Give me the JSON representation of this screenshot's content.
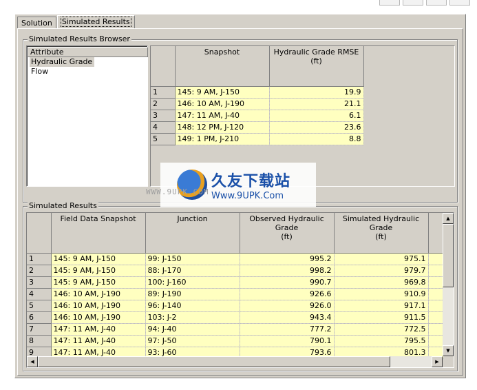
{
  "top_icons": [
    "toolbar-icon-1",
    "toolbar-icon-2",
    "toolbar-icon-3",
    "toolbar-icon-4"
  ],
  "tabs": [
    {
      "label": "Solution"
    },
    {
      "label": "Simulated Results"
    }
  ],
  "browser": {
    "title": "Simulated Results Browser",
    "attribute_header": "Attribute",
    "attributes": [
      "Hydraulic Grade",
      "Flow"
    ],
    "selected_attribute": "Hydraulic Grade",
    "columns": [
      "Snapshot",
      "Hydraulic Grade RMSE\n(ft)"
    ],
    "rows": [
      {
        "n": "1",
        "snapshot": "145: 9 AM, J-150",
        "rmse": "19.9"
      },
      {
        "n": "2",
        "snapshot": "146: 10 AM, J-190",
        "rmse": "21.1"
      },
      {
        "n": "3",
        "snapshot": "147: 11 AM, J-40",
        "rmse": "6.1"
      },
      {
        "n": "4",
        "snapshot": "148: 12 PM, J-120",
        "rmse": "23.6"
      },
      {
        "n": "5",
        "snapshot": "149: 1 PM, J-210",
        "rmse": "8.8"
      }
    ]
  },
  "results": {
    "title": "Simulated Results",
    "columns": [
      "Field Data Snapshot",
      "Junction",
      "Observed Hydraulic Grade\n(ft)",
      "Simulated Hydraulic\nGrade\n(ft)"
    ],
    "rows": [
      {
        "n": "1",
        "snapshot": "145: 9 AM, J-150",
        "junction": "99: J-150",
        "observed": "995.2",
        "simulated": "975.1"
      },
      {
        "n": "2",
        "snapshot": "145: 9 AM, J-150",
        "junction": "88: J-170",
        "observed": "998.2",
        "simulated": "979.7"
      },
      {
        "n": "3",
        "snapshot": "145: 9 AM, J-150",
        "junction": "100: J-160",
        "observed": "990.7",
        "simulated": "969.8"
      },
      {
        "n": "4",
        "snapshot": "146: 10 AM, J-190",
        "junction": "89: J-190",
        "observed": "926.6",
        "simulated": "910.9"
      },
      {
        "n": "5",
        "snapshot": "146: 10 AM, J-190",
        "junction": "96: J-140",
        "observed": "926.0",
        "simulated": "917.1"
      },
      {
        "n": "6",
        "snapshot": "146: 10 AM, J-190",
        "junction": "103: J-2",
        "observed": "943.4",
        "simulated": "911.5"
      },
      {
        "n": "7",
        "snapshot": "147: 11 AM, J-40",
        "junction": "94: J-40",
        "observed": "777.2",
        "simulated": "772.5"
      },
      {
        "n": "8",
        "snapshot": "147: 11 AM, J-40",
        "junction": "97: J-50",
        "observed": "790.1",
        "simulated": "795.5"
      },
      {
        "n": "9",
        "snapshot": "147: 11 AM, J-40",
        "junction": "93: J-60",
        "observed": "793.6",
        "simulated": "801.3"
      }
    ]
  },
  "watermark": {
    "title": "久友下载站",
    "url": "Www.9UPK.Com",
    "side_text": "WWW.9UPK.COM"
  },
  "colors": {
    "dialog_bg": "#d4d0c8",
    "cell_bg": "#ffffc0",
    "watermark_text": "#1a50a8"
  }
}
